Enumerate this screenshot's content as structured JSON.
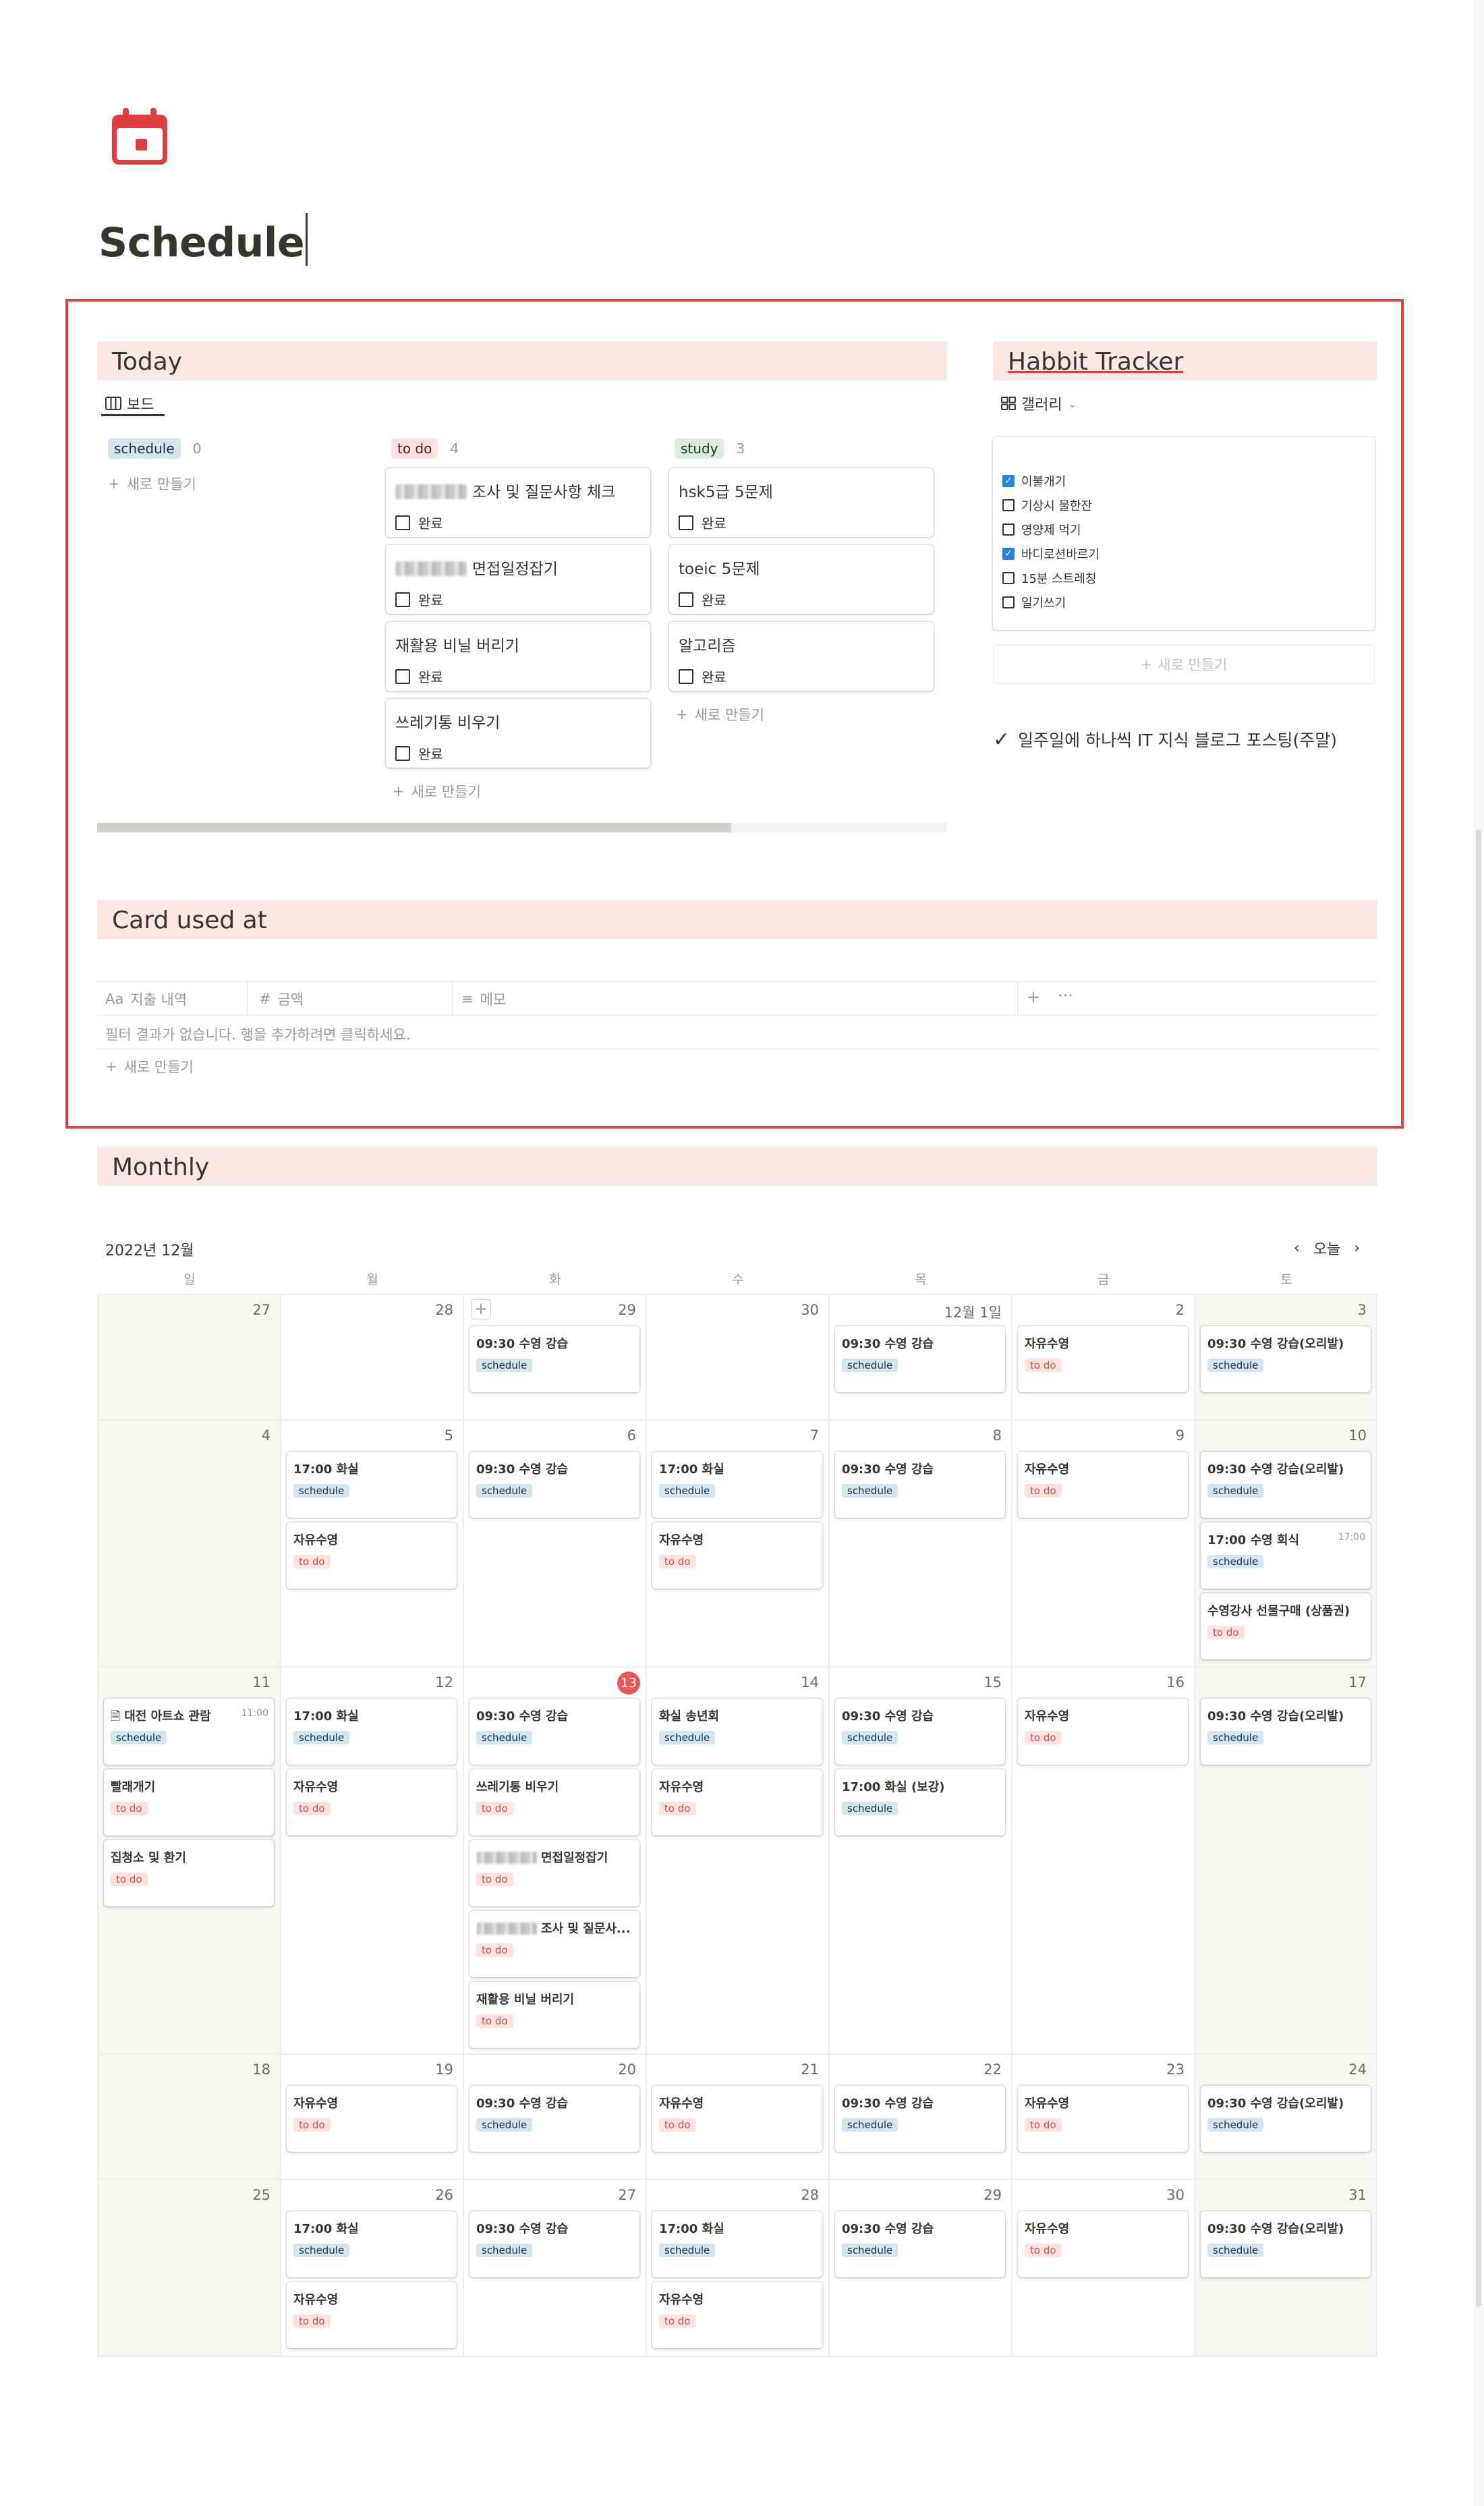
{
  "page": {
    "title": "Schedule",
    "icon": "calendar-icon",
    "accent": "#e03e3e"
  },
  "today": {
    "title": "Today",
    "view_tab": "보드",
    "columns": [
      {
        "label": "schedule",
        "count": "0",
        "color": "blue",
        "cards": []
      },
      {
        "label": "to do",
        "count": "4",
        "color": "red",
        "cards": [
          {
            "title": "조사 및 질문사항 체크",
            "blurred": true,
            "check": "완료"
          },
          {
            "title": "면접일정잡기",
            "blurred": true,
            "check": "완료"
          },
          {
            "title": "재활용 비닐 버리기",
            "blurred": false,
            "check": "완료"
          },
          {
            "title": "쓰레기통 비우기",
            "blurred": false,
            "check": "완료"
          }
        ]
      },
      {
        "label": "study",
        "count": "3",
        "color": "green",
        "cards": [
          {
            "title": "hsk5급 5문제",
            "blurred": false,
            "check": "완료"
          },
          {
            "title": "toeic 5문제",
            "blurred": false,
            "check": "완료"
          },
          {
            "title": "알고리즘",
            "blurred": false,
            "check": "완료"
          }
        ]
      }
    ],
    "new_label": "새로 만들기"
  },
  "habbit": {
    "title": "Habbit Tracker",
    "view_tab": "갤러리",
    "items": [
      {
        "label": "이불개기",
        "checked": true
      },
      {
        "label": "기상시 물한잔",
        "checked": false
      },
      {
        "label": "영양제 먹기",
        "checked": false
      },
      {
        "label": "바디로션바르기",
        "checked": true
      },
      {
        "label": "15분 스트레칭",
        "checked": false
      },
      {
        "label": "일기쓰기",
        "checked": false
      }
    ],
    "new_label": "새로 만들기",
    "note": "일주일에 하나씩 IT 지식 블로그 포스팅(주말)"
  },
  "card": {
    "title": "Card used at",
    "columns": [
      "지출 내역",
      "금액",
      "메모"
    ],
    "col_icons": [
      "Aa",
      "#",
      "≡"
    ],
    "empty_msg": "필터 결과가 없습니다. 행을 추가하려면 클릭하세요.",
    "new_label": "새로 만들기"
  },
  "monthly": {
    "title": "Monthly",
    "month_label": "2022년 12월",
    "today_label": "오늘",
    "weekdays": [
      "일",
      "월",
      "화",
      "수",
      "목",
      "금",
      "토"
    ],
    "weeks": [
      {
        "days": [
          {
            "d": "27",
            "events": []
          },
          {
            "d": "28",
            "events": []
          },
          {
            "d": "29",
            "plus": true,
            "events": [
              {
                "t": "09:30 수영 강습",
                "tag": "schedule"
              }
            ]
          },
          {
            "d": "30",
            "events": []
          },
          {
            "d": "12월 1일",
            "events": [
              {
                "t": "09:30 수영 강습",
                "tag": "schedule"
              }
            ]
          },
          {
            "d": "2",
            "events": [
              {
                "t": "자유수영",
                "tag": "to do"
              }
            ]
          },
          {
            "d": "3",
            "events": [
              {
                "t": "09:30 수영 강습(오리발)",
                "tag": "schedule"
              }
            ]
          }
        ]
      },
      {
        "days": [
          {
            "d": "4",
            "events": []
          },
          {
            "d": "5",
            "events": [
              {
                "t": "17:00 화실",
                "tag": "schedule"
              },
              {
                "t": "자유수영",
                "tag": "to do"
              }
            ]
          },
          {
            "d": "6",
            "events": [
              {
                "t": "09:30 수영 강습",
                "tag": "schedule"
              }
            ]
          },
          {
            "d": "7",
            "events": [
              {
                "t": "17:00 화실",
                "tag": "schedule"
              },
              {
                "t": "자유수영",
                "tag": "to do"
              }
            ]
          },
          {
            "d": "8",
            "events": [
              {
                "t": "09:30 수영 강습",
                "tag": "schedule"
              }
            ]
          },
          {
            "d": "9",
            "events": [
              {
                "t": "자유수영",
                "tag": "to do"
              }
            ]
          },
          {
            "d": "10",
            "events": [
              {
                "t": "09:30 수영 강습(오리발)",
                "tag": "schedule"
              },
              {
                "t": "17:00 수영 회식",
                "tag": "schedule",
                "time": "17:00"
              },
              {
                "t": "수영강사 선물구매 (상품권)",
                "tag": "to do"
              }
            ]
          }
        ]
      },
      {
        "days": [
          {
            "d": "11",
            "events": [
              {
                "t": "대전 아트쇼 관람",
                "tag": "schedule",
                "time": "11:00",
                "doc": true
              },
              {
                "t": "빨래개기",
                "tag": "to do"
              },
              {
                "t": "집청소 및 환기",
                "tag": "to do"
              }
            ]
          },
          {
            "d": "12",
            "events": [
              {
                "t": "17:00 화실",
                "tag": "schedule"
              },
              {
                "t": "자유수영",
                "tag": "to do"
              }
            ]
          },
          {
            "d": "13",
            "today": true,
            "events": [
              {
                "t": "09:30 수영 강습",
                "tag": "schedule"
              },
              {
                "t": "쓰레기통 비우기",
                "tag": "to do"
              },
              {
                "t": "면접일정잡기",
                "tag": "to do",
                "blurred": true
              },
              {
                "t": "조사 및 질문사...",
                "tag": "to do",
                "blurred": true
              },
              {
                "t": "재활용 비닐 버리기",
                "tag": "to do"
              }
            ]
          },
          {
            "d": "14",
            "events": [
              {
                "t": "화실 송년회",
                "tag": "schedule"
              },
              {
                "t": "자유수영",
                "tag": "to do"
              }
            ]
          },
          {
            "d": "15",
            "events": [
              {
                "t": "09:30 수영 강습",
                "tag": "schedule"
              },
              {
                "t": "17:00 화실 (보강)",
                "tag": "schedule"
              }
            ]
          },
          {
            "d": "16",
            "events": [
              {
                "t": "자유수영",
                "tag": "to do"
              }
            ]
          },
          {
            "d": "17",
            "events": [
              {
                "t": "09:30 수영 강습(오리발)",
                "tag": "schedule"
              }
            ]
          }
        ]
      },
      {
        "days": [
          {
            "d": "18",
            "events": []
          },
          {
            "d": "19",
            "events": [
              {
                "t": "자유수영",
                "tag": "to do"
              }
            ]
          },
          {
            "d": "20",
            "events": [
              {
                "t": "09:30 수영 강습",
                "tag": "schedule"
              }
            ]
          },
          {
            "d": "21",
            "events": [
              {
                "t": "자유수영",
                "tag": "to do"
              }
            ]
          },
          {
            "d": "22",
            "events": [
              {
                "t": "09:30 수영 강습",
                "tag": "schedule"
              }
            ]
          },
          {
            "d": "23",
            "events": [
              {
                "t": "자유수영",
                "tag": "to do"
              }
            ]
          },
          {
            "d": "24",
            "events": [
              {
                "t": "09:30 수영 강습(오리발)",
                "tag": "schedule"
              }
            ]
          }
        ]
      },
      {
        "days": [
          {
            "d": "25",
            "events": []
          },
          {
            "d": "26",
            "events": [
              {
                "t": "17:00 화실",
                "tag": "schedule"
              },
              {
                "t": "자유수영",
                "tag": "to do"
              }
            ]
          },
          {
            "d": "27",
            "events": [
              {
                "t": "09:30 수영 강습",
                "tag": "schedule"
              }
            ]
          },
          {
            "d": "28",
            "events": [
              {
                "t": "17:00 화실",
                "tag": "schedule"
              },
              {
                "t": "자유수영",
                "tag": "to do"
              }
            ]
          },
          {
            "d": "29",
            "events": [
              {
                "t": "09:30 수영 강습",
                "tag": "schedule"
              }
            ]
          },
          {
            "d": "30",
            "events": [
              {
                "t": "자유수영",
                "tag": "to do"
              }
            ]
          },
          {
            "d": "31",
            "events": [
              {
                "t": "09:30 수영 강습(오리발)",
                "tag": "schedule"
              }
            ]
          }
        ]
      }
    ]
  }
}
